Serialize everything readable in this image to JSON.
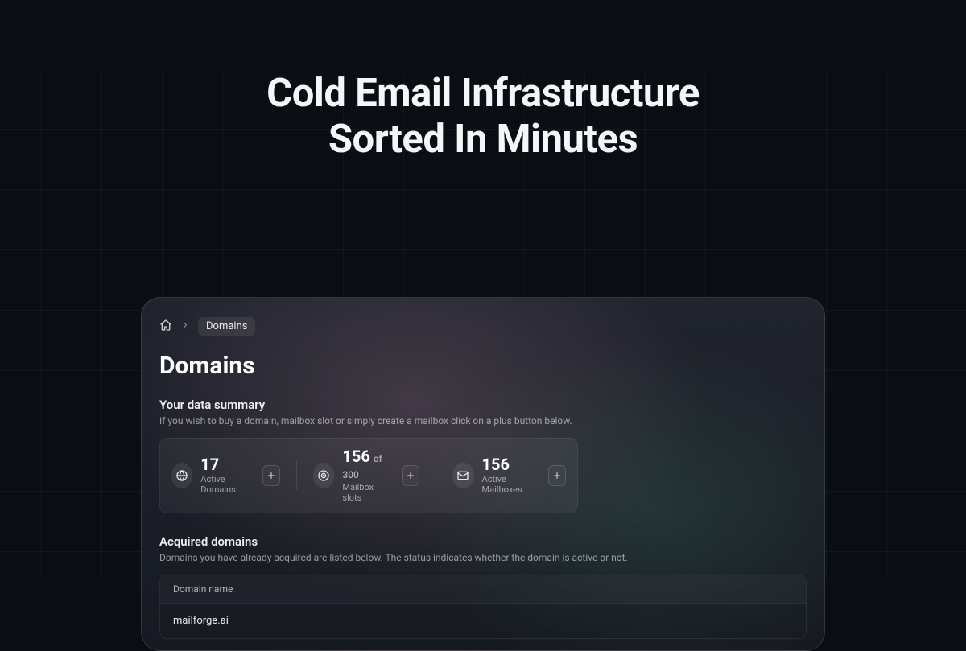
{
  "headline_line1": "Cold Email Infrastructure",
  "headline_line2": "Sorted In Minutes",
  "breadcrumb": {
    "current": "Domains"
  },
  "page_title": "Domains",
  "summary": {
    "title": "Your data summary",
    "subtitle": "If you wish to buy a domain, mailbox slot or simply create a mailbox click on a plus button below."
  },
  "stats": {
    "domains": {
      "value": "17",
      "label": "Active Domains"
    },
    "slots": {
      "value": "156",
      "of": "of 300",
      "label": "Mailbox slots"
    },
    "mailboxes": {
      "value": "156",
      "label": "Active Mailboxes"
    }
  },
  "acquired": {
    "title": "Acquired domains",
    "subtitle": "Domains you have already acquired are listed below. The status indicates whether the domain is active or not."
  },
  "table": {
    "header": "Domain name",
    "rows": [
      "mailforge.ai"
    ]
  }
}
